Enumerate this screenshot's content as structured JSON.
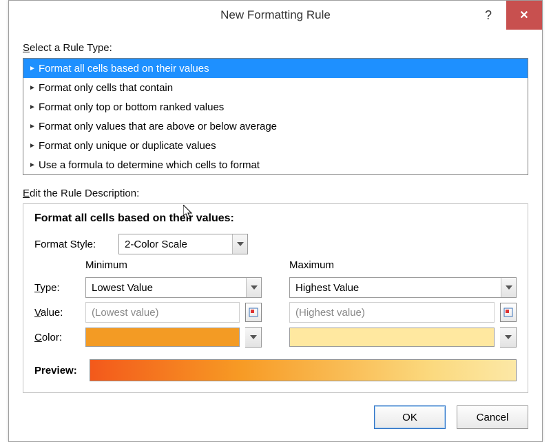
{
  "window": {
    "title": "New Formatting Rule",
    "help_icon": "?",
    "close_icon": "✕"
  },
  "section_select_label_prefix": "S",
  "section_select_label_rest": "elect a Rule Type:",
  "rule_types": [
    "Format all cells based on their values",
    "Format only cells that contain",
    "Format only top or bottom ranked values",
    "Format only values that are above or below average",
    "Format only unique or duplicate values",
    "Use a formula to determine which cells to format"
  ],
  "selected_rule_index": 0,
  "edit_label_prefix": "E",
  "edit_label_rest": "dit the Rule Description:",
  "desc": {
    "heading": "Format all cells based on their values:",
    "format_style_prefix": "F",
    "format_style_rest": "ormat Style:",
    "format_style_value": "2-Color Scale",
    "minimum_label": "Minimum",
    "maximum_label": "Maximum",
    "type_prefix": "T",
    "type_rest": "ype:",
    "value_prefix": "V",
    "value_rest": "alue:",
    "color_prefix": "C",
    "color_rest": "olor:",
    "min_type": "Lowest Value",
    "max_type": "Highest Value",
    "min_value_placeholder": "(Lowest value)",
    "max_value_placeholder": "(Highest value)",
    "min_color": "#f39b24",
    "max_color": "#ffe8a0",
    "preview_label": "Preview:"
  },
  "footer": {
    "ok": "OK",
    "cancel": "Cancel"
  }
}
